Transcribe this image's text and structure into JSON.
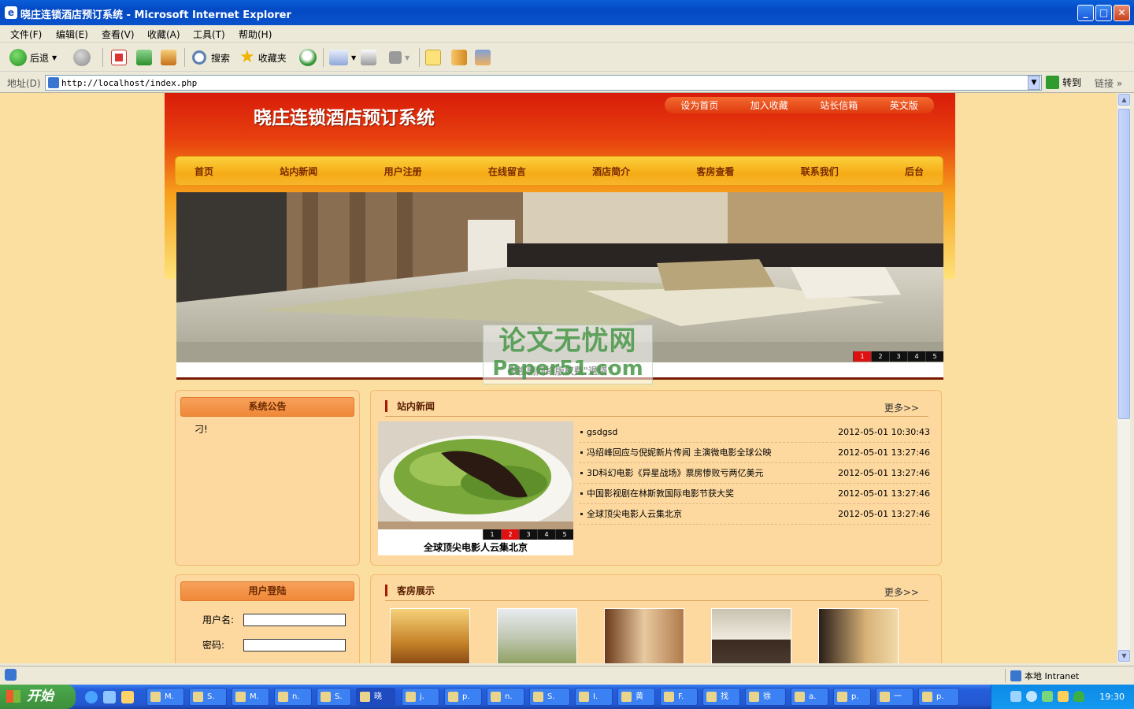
{
  "window": {
    "title": "晓庄连锁酒店预订系统 - Microsoft Internet Explorer",
    "btn_min": "_",
    "btn_max": "□",
    "btn_close": "✕"
  },
  "menu": [
    "文件(F)",
    "编辑(E)",
    "查看(V)",
    "收藏(A)",
    "工具(T)",
    "帮助(H)"
  ],
  "toolbar": {
    "back": "后退",
    "search": "搜索",
    "favorites": "收藏夹"
  },
  "address": {
    "label": "地址(D)",
    "url": "http://localhost/index.php",
    "go": "转到",
    "links": "链接 »"
  },
  "status": {
    "zone": "本地 Intranet"
  },
  "taskbar": {
    "start": "开始",
    "buttons": [
      "M.",
      "S.",
      "M.",
      "n.",
      "S.",
      "晓",
      "j.",
      "p.",
      "n.",
      "S.",
      "I.",
      "黄",
      "F.",
      "找",
      "徐",
      "a.",
      "p.",
      "一",
      "p."
    ],
    "active_index": 5,
    "clock": "19:30"
  },
  "site": {
    "title": "晓庄连锁酒店预订系统",
    "toplinks": [
      "设为首页",
      "加入收藏",
      "站长信箱",
      "英文版"
    ],
    "nav": [
      "首页",
      "站内新闻",
      "用户注册",
      "在线留言",
      "酒店简介",
      "客房查看",
      "联系我们",
      "后台"
    ]
  },
  "banner": {
    "caption": "影视剧网络版权费\"退烧\"",
    "pages": [
      "1",
      "2",
      "3",
      "4",
      "5"
    ],
    "active": 0
  },
  "watermark": {
    "line1": "论文无忧网",
    "line2": "Paper51.com"
  },
  "notice": {
    "title": "系统公告",
    "body": "刁!"
  },
  "login": {
    "title": "用户登陆",
    "username_label": "用户名:",
    "password_label": "密码:",
    "username": "",
    "password": ""
  },
  "news": {
    "title": "站内新闻",
    "more": "更多>>",
    "slide_caption": "全球顶尖电影人云集北京",
    "slide_pages": [
      "1",
      "2",
      "3",
      "4",
      "5"
    ],
    "slide_active": 1,
    "items": [
      {
        "title": "gsdgsd",
        "date": "2012-05-01 10:30:43"
      },
      {
        "title": "冯绍峰回应与倪妮新片传闻 主演微电影全球公映",
        "date": "2012-05-01 13:27:46"
      },
      {
        "title": "3D科幻电影《异星战场》票房惨败亏两亿美元",
        "date": "2012-05-01 13:27:46"
      },
      {
        "title": "中国影视剧在林斯敦国际电影节获大奖",
        "date": "2012-05-01 13:27:46"
      },
      {
        "title": "全球顶尖电影人云集北京",
        "date": "2012-05-01 13:27:46"
      }
    ]
  },
  "rooms": {
    "title": "客房展示",
    "more": "更多>>",
    "count": 5
  }
}
